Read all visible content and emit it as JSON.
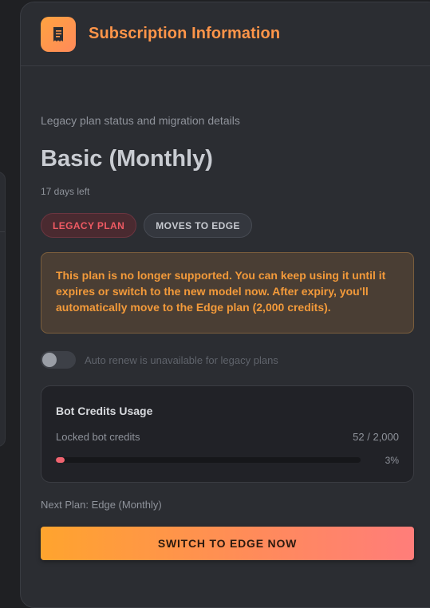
{
  "header": {
    "title": "Subscription Information",
    "icon": "receipt-icon"
  },
  "plan": {
    "subtitle": "Legacy plan status and migration details",
    "name": "Basic (Monthly)",
    "days_left": "17 days left",
    "badges": {
      "legacy": "LEGACY PLAN",
      "moves": "MOVES TO EDGE"
    },
    "warning": "This plan is no longer supported. You can keep using it until it expires or switch to the new model now. After expiry, you'll automatically move to the Edge plan (2,000 credits).",
    "auto_renew_label": "Auto renew is unavailable for legacy plans",
    "auto_renew_enabled": false
  },
  "usage": {
    "title": "Bot Credits Usage",
    "label": "Locked bot credits",
    "count": "52 / 2,000",
    "percent_label": "3%",
    "percent": 3
  },
  "next_plan": "Next Plan: Edge (Monthly)",
  "cta_label": "SWITCH TO EDGE NOW",
  "colors": {
    "accent": "#ff9549",
    "danger": "#ef5a63",
    "warning_text": "#f39a3a"
  }
}
